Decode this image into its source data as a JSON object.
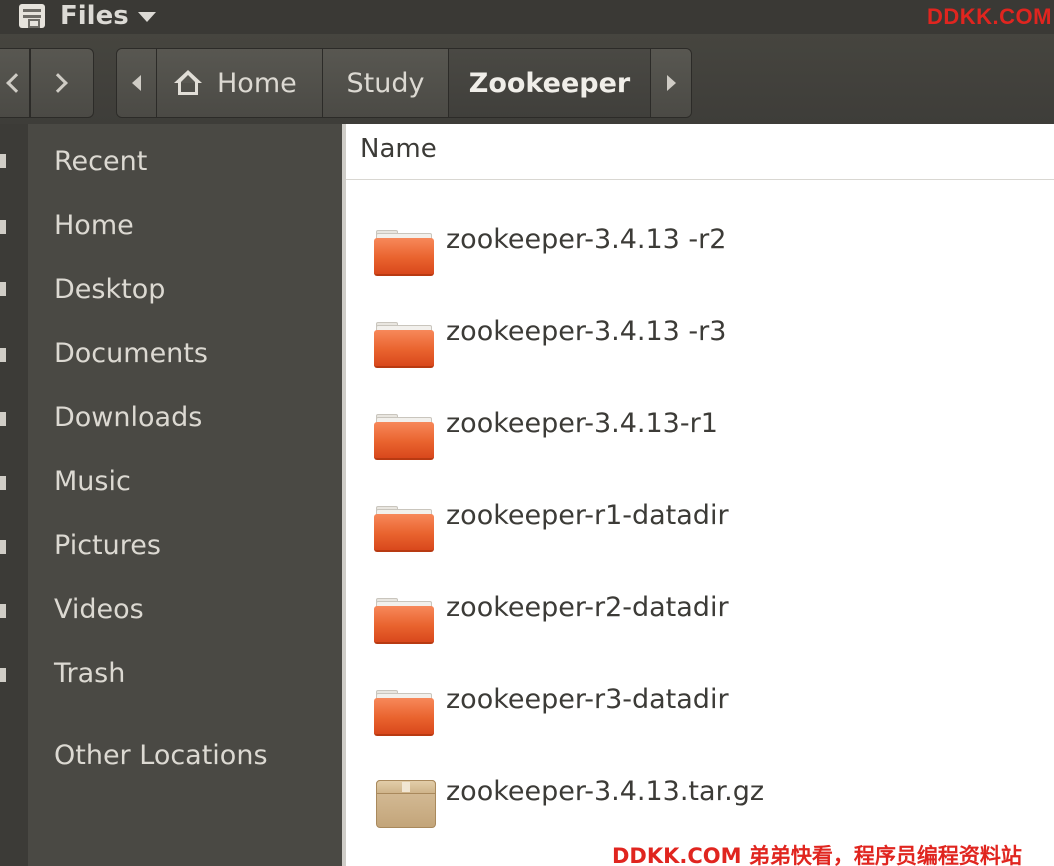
{
  "topbar": {
    "app_name": "Files",
    "icon": "file-cabinet-icon"
  },
  "watermarks": {
    "top": "DDKK.COM",
    "bottom": "DDKK.COM 弟弟快看，程序员编程资料站"
  },
  "toolbar": {
    "back_icon": "chevron-left-icon",
    "forward_icon": "chevron-right-icon"
  },
  "breadcrumb": {
    "home": "Home",
    "study": "Study",
    "current": "Zookeeper"
  },
  "sidebar": {
    "items": [
      {
        "label": "Recent"
      },
      {
        "label": "Home"
      },
      {
        "label": "Desktop"
      },
      {
        "label": "Documents"
      },
      {
        "label": "Downloads"
      },
      {
        "label": "Music"
      },
      {
        "label": "Pictures"
      },
      {
        "label": "Videos"
      },
      {
        "label": "Trash"
      },
      {
        "label": "Other Locations"
      }
    ]
  },
  "files": {
    "column_name": "Name",
    "items": [
      {
        "name": "zookeeper-3.4.13 -r2",
        "type": "folder"
      },
      {
        "name": "zookeeper-3.4.13 -r3",
        "type": "folder"
      },
      {
        "name": "zookeeper-3.4.13-r1",
        "type": "folder"
      },
      {
        "name": "zookeeper-r1-datadir",
        "type": "folder"
      },
      {
        "name": "zookeeper-r2-datadir",
        "type": "folder"
      },
      {
        "name": "zookeeper-r3-datadir",
        "type": "folder"
      },
      {
        "name": "zookeeper-3.4.13.tar.gz",
        "type": "archive"
      }
    ]
  }
}
